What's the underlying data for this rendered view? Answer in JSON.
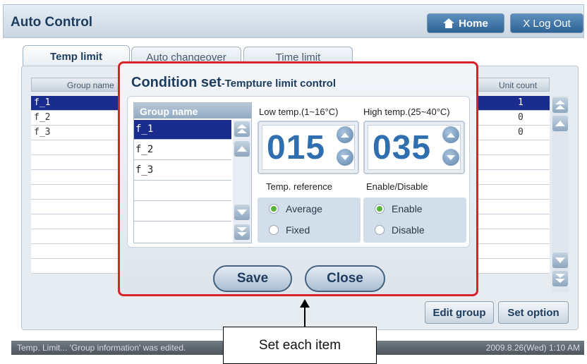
{
  "app": {
    "title": "Auto Control",
    "home_label": "Home",
    "logout_label": "X Log Out"
  },
  "tabs": [
    "Temp limit",
    "Auto changeover",
    "Time limit"
  ],
  "table": {
    "headers": {
      "group": "Group name",
      "unit_count": "Unit count"
    },
    "rows": [
      {
        "name": "f_1",
        "count": "1"
      },
      {
        "name": "f_2",
        "count": "0"
      },
      {
        "name": "f_3",
        "count": "0"
      }
    ]
  },
  "footer_buttons": {
    "edit_group": "Edit group",
    "set_option": "Set option"
  },
  "status": {
    "message": "Temp. Limit... 'Group information' was edited.",
    "datetime": "2009.8.26(Wed)  1:10 AM"
  },
  "dialog": {
    "title_main": "Condition set",
    "title_sub": "-Tempture limit control",
    "group_list": {
      "header": "Group name",
      "items": [
        "f_1",
        "f_2",
        "f_3",
        "",
        "",
        ""
      ]
    },
    "low_temp": {
      "label": "Low temp.(1~16°C)",
      "value": "015"
    },
    "high_temp": {
      "label": "High temp.(25~40°C)",
      "value": "035"
    },
    "temp_reference": {
      "label": "Temp. reference",
      "options": [
        "Average",
        "Fixed"
      ],
      "selected": "Average"
    },
    "enable_disable": {
      "label": "Enable/Disable",
      "options": [
        "Enable",
        "Disable"
      ],
      "selected": "Enable"
    },
    "save_label": "Save",
    "close_label": "Close"
  },
  "callout": {
    "text": "Set each item"
  },
  "colors": {
    "accent": "#2f6fb0",
    "selection": "#1a2d8f",
    "dialog_border": "#d9232b",
    "radio_on": "#58b33a"
  }
}
